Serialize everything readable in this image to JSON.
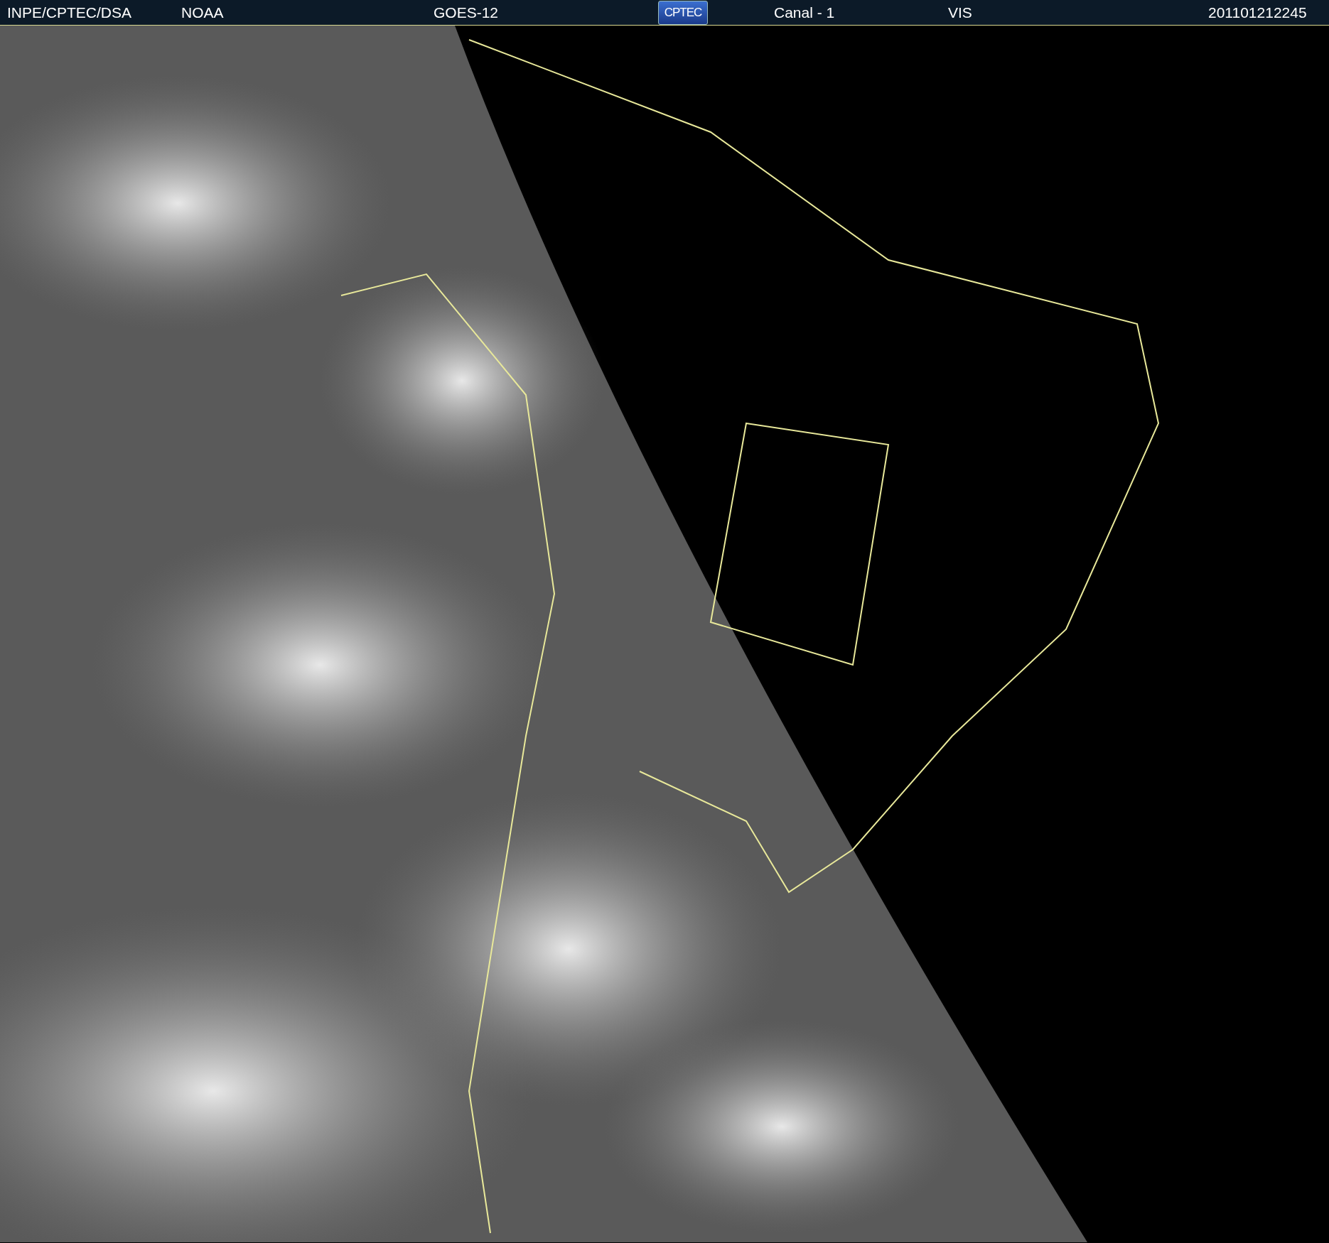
{
  "header": {
    "fields": [
      {
        "kind": "text",
        "text": "INPE/CPTEC/DSA"
      },
      {
        "kind": "text",
        "text": "NOAA"
      },
      {
        "kind": "text",
        "text": "GOES-12"
      },
      {
        "kind": "logo",
        "text": "CPTEC"
      },
      {
        "kind": "text",
        "text": "Canal - 1"
      },
      {
        "kind": "text",
        "text": "VIS"
      },
      {
        "kind": "text",
        "text": "201101212245"
      }
    ]
  }
}
